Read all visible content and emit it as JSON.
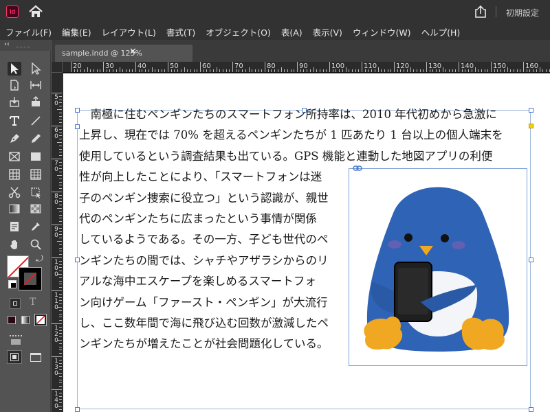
{
  "app": {
    "logo_text": "Id",
    "workspace_label": "初期設定",
    "icons": [
      "home-icon",
      "share-icon"
    ]
  },
  "menu": [
    "ファイル(F)",
    "編集(E)",
    "レイアウト(L)",
    "書式(T)",
    "オブジェクト(O)",
    "表(A)",
    "表示(V)",
    "ウィンドウ(W)",
    "ヘルプ(H)"
  ],
  "toolpanel": {
    "collapse_label": "‹‹",
    "tools": [
      "selection-tool",
      "direct-selection-tool",
      "page-tool",
      "gap-tool",
      "content-collector-tool",
      "content-placer-tool",
      "type-tool",
      "line-tool",
      "pen-tool",
      "pencil-tool",
      "rectangle-frame-tool",
      "rectangle-tool",
      "table-tool",
      "grid-tool",
      "scissors-tool",
      "free-transform-tool",
      "gradient-swatch-tool",
      "gradient-feather-tool",
      "note-tool",
      "eyedropper-tool",
      "hand-tool",
      "zoom-tool"
    ],
    "type_toggle_label": "T"
  },
  "document": {
    "tab_label": "sample.indd @ 125%",
    "close_glyph": "✕"
  },
  "rulers": {
    "horizontal_labels": [
      "20",
      "30",
      "40",
      "50",
      "60",
      "70",
      "80",
      "90",
      "100",
      "110",
      "120",
      "130",
      "140",
      "150",
      "160"
    ],
    "vertical_labels": [
      "50",
      "60",
      "70",
      "80",
      "90",
      "100",
      "110",
      "120",
      "130",
      "140"
    ]
  },
  "content": {
    "lines": [
      "　南極に住むペンギンたちのスマートフォン所持率は、2010 年代初めから急激に",
      "上昇し、現在では 70% を超えるペンギンたちが 1 匹あたり 1 台以上の個人端末を",
      "使用しているという調査結果も出ている。GPS 機能と連動した地図アプリの利便",
      "性が向上したことにより、「スマートフォンは迷",
      "子のペンギン捜索に役立つ」という認識が、親世",
      "代のペンギンたちに広まったという事情が関係",
      "しているようである。その一方、子ども世代のペ",
      "ンギンたちの間では、シャチやアザラシからのリ",
      "アルな海中エスケープを楽しめるスマートフォ",
      "ン向けゲーム「ファースト・ペンギン」が大流行",
      "し、ここ数年間で海に飛び込む回数が激減したペ",
      "ンギンたちが増えたことが社会問題化している。"
    ]
  },
  "colors": {
    "chrome_dark": "#323232",
    "panel": "#535353",
    "frame_edge": "#4a78c8",
    "penguin_blue": "#2f63b5",
    "penguin_feet": "#f0a822",
    "phone": "#1f1f1f"
  }
}
